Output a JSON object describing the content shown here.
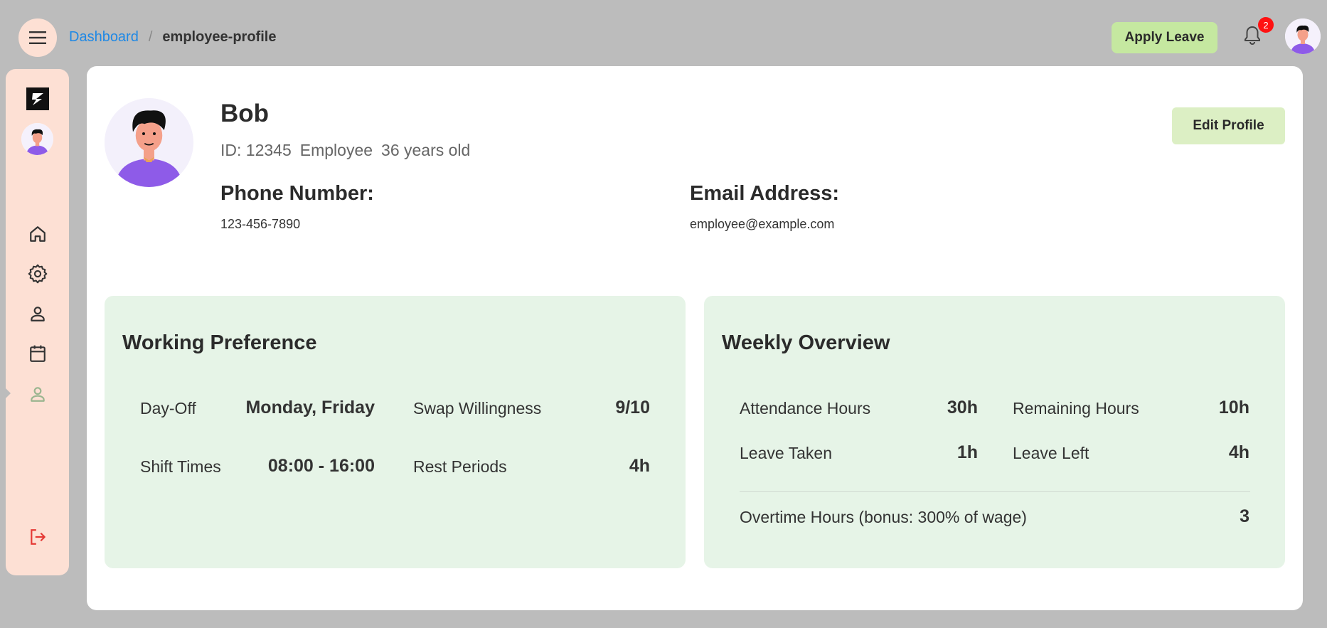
{
  "header": {
    "breadcrumb": {
      "link": "Dashboard",
      "separator": "/",
      "current": "employee-profile"
    },
    "apply_leave_label": "Apply Leave",
    "notification_count": "2"
  },
  "sidebar": {
    "items": [
      {
        "icon": "home-icon"
      },
      {
        "icon": "settings-icon"
      },
      {
        "icon": "person-icon"
      },
      {
        "icon": "calendar-icon"
      },
      {
        "icon": "person-active-icon"
      }
    ],
    "logout_icon": "logout-icon"
  },
  "profile": {
    "name": "Bob",
    "id_text": "ID: 12345",
    "role": "Employee",
    "age_text": "36 years old",
    "phone_label": "Phone Number:",
    "phone_value": "123-456-7890",
    "email_label": "Email Address:",
    "email_value": "employee@example.com",
    "edit_label": "Edit Profile"
  },
  "working_preference": {
    "title": "Working Preference",
    "rows": [
      {
        "label": "Day-Off",
        "value": "Monday, Friday"
      },
      {
        "label": "Swap Willingness",
        "value": "9/10"
      },
      {
        "label": "Shift Times",
        "value": "08:00 - 16:00"
      },
      {
        "label": "Rest Periods",
        "value": "4h"
      }
    ]
  },
  "weekly_overview": {
    "title": "Weekly Overview",
    "rows": [
      {
        "label": "Attendance Hours",
        "value": "30h"
      },
      {
        "label": "Remaining Hours",
        "value": "10h"
      },
      {
        "label": "Leave Taken",
        "value": "1h"
      },
      {
        "label": "Leave Left",
        "value": "4h"
      }
    ],
    "overtime": {
      "label": "Overtime Hours (bonus: 300% of wage)",
      "value": "3"
    }
  },
  "colors": {
    "accent_link": "#1e88e5",
    "sidebar_bg": "#fde0d4",
    "apply_btn": "#c5e8a0",
    "panel_bg": "#e6f4e7",
    "badge": "#ff1111",
    "logout": "#e53935"
  }
}
